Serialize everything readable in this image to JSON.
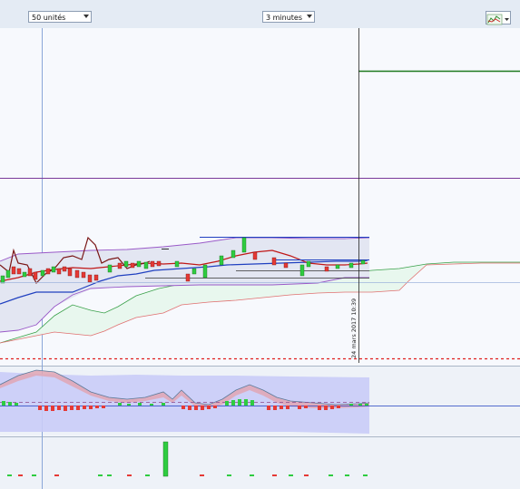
{
  "toolbar": {
    "units_select": "50 unités",
    "interval_select": "3 minutes",
    "chart_type_button": "chart-type-icon"
  },
  "crosshair": {
    "datetime_label": "24 mars 2017 10:39"
  },
  "colors": {
    "up_candle": "#2ecc40",
    "down_candle": "#e53935",
    "cloud_fill": "#e8f7ee",
    "bollinger_fill": "#e3e6f2",
    "level_line": "#1e7a1e",
    "purple_line": "#7a3a9a",
    "dashed_level": "#e02020",
    "oscillator_fill": "#c9ccf7"
  }
}
